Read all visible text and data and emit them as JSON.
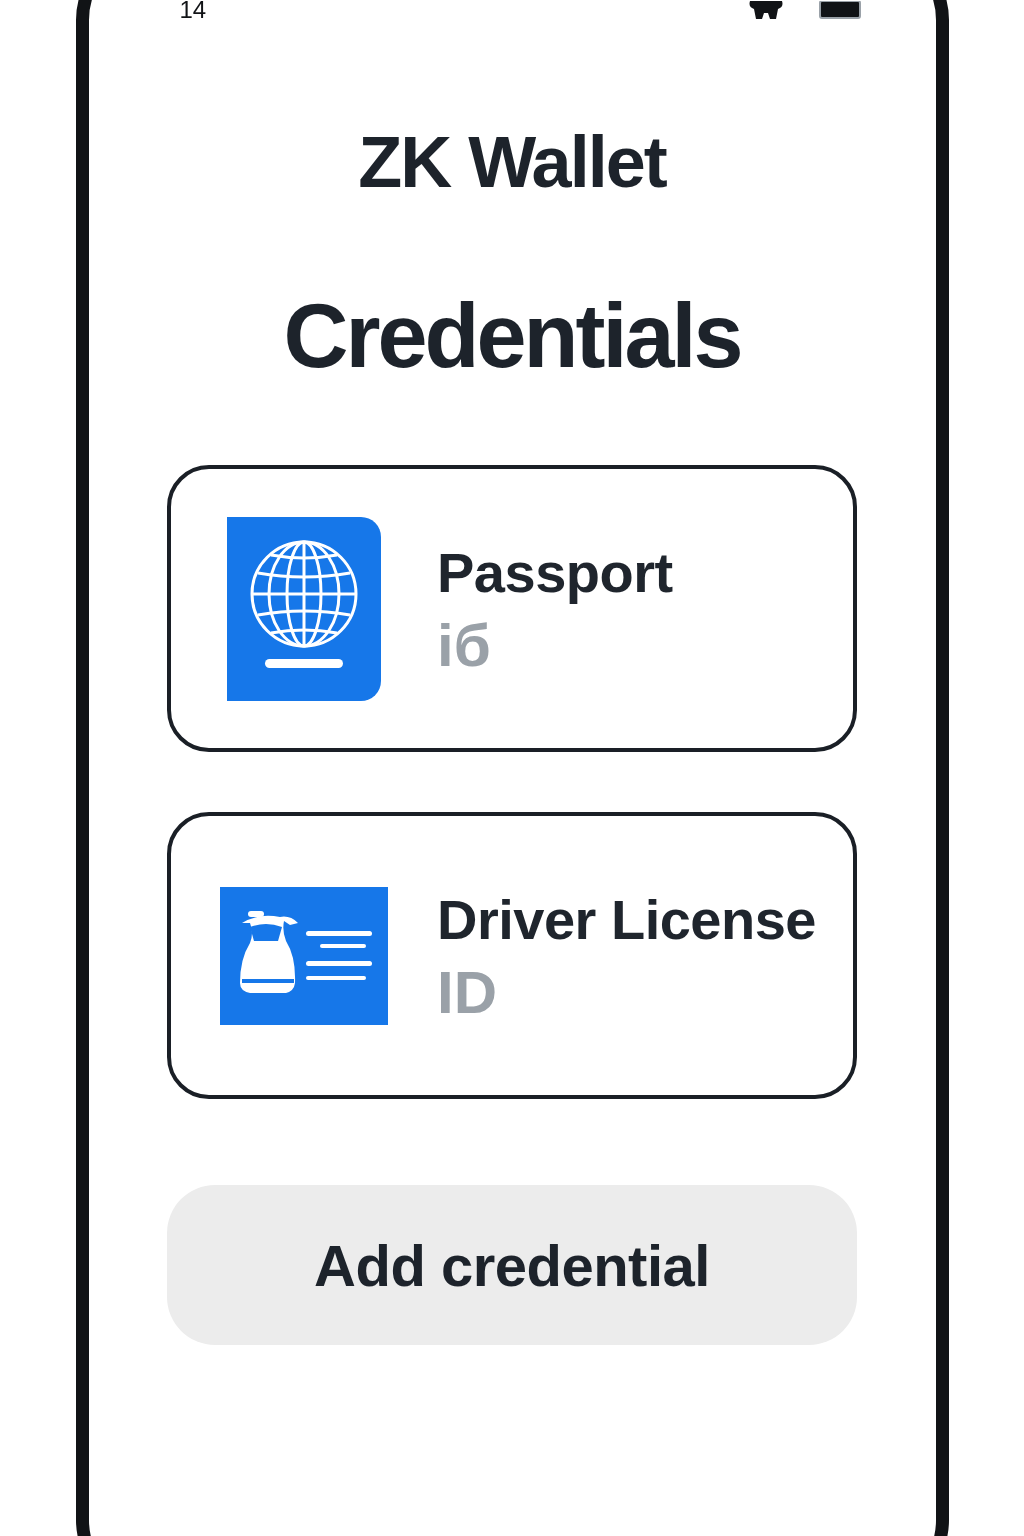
{
  "status_bar": {
    "time": "14"
  },
  "header": {
    "title": "ZK Wallet"
  },
  "section": {
    "title": "Credentials"
  },
  "credentials": [
    {
      "kind": "passport",
      "name": "Passport",
      "subtitle": "iб"
    },
    {
      "kind": "license",
      "name": "Driver License",
      "subtitle": "ID"
    }
  ],
  "add_button": {
    "label": "Add credential"
  }
}
